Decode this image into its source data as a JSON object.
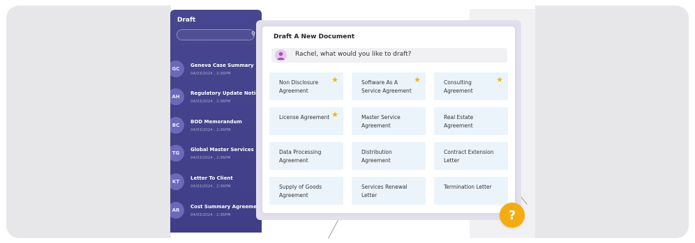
{
  "sidebar": {
    "title": "Draft",
    "search_icon": "search-icon",
    "items": [
      {
        "initials": "GC",
        "title": "Geneva Case Summary",
        "date": "04/03/2024 , 2:36PM"
      },
      {
        "initials": "AH",
        "title": "Regulatory Update Notice",
        "date": "04/03/2024 , 2:36PM"
      },
      {
        "initials": "BC",
        "title": "BOD Memorandum",
        "date": "04/03/2024 , 2:36PM"
      },
      {
        "initials": "TG",
        "title": "Global Master Services",
        "date": "04/03/2024 , 2:36PM"
      },
      {
        "initials": "KT",
        "title": "Letter To Client",
        "date": "04/03/2024 , 2:36PM"
      },
      {
        "initials": "AR",
        "title": "Cost Summary Agreement",
        "date": "04/03/2024 , 2:36PM"
      }
    ]
  },
  "modal": {
    "title": "Draft A New Document",
    "prompt": "Rachel, what would you like to draft?",
    "cards": [
      {
        "label": "Non Disclosure Agreement",
        "starred": true
      },
      {
        "label": "Software As A Service Agreement",
        "starred": true
      },
      {
        "label": "Consulting Agreement",
        "starred": true
      },
      {
        "label": "License Agreement",
        "starred": true
      },
      {
        "label": "Master Service Agreement",
        "starred": false
      },
      {
        "label": "Real Estate Agreement",
        "starred": false
      },
      {
        "label": "Data Processing Agreement",
        "starred": false
      },
      {
        "label": "Distribution Agreement",
        "starred": false
      },
      {
        "label": "Contract Extension Letter",
        "starred": false
      },
      {
        "label": "Supply of Goods Agreement",
        "starred": false
      },
      {
        "label": "Services Renewal Letter",
        "starred": false
      },
      {
        "label": "Termination Letter",
        "starred": false
      }
    ]
  },
  "help_button": {
    "label": "?"
  },
  "colors": {
    "sidebar_bg": "#474690",
    "avatar_bg": "#6b69b9",
    "card_bg": "#ebf4fb",
    "star": "#f3b212",
    "help": "#f3ad11"
  }
}
